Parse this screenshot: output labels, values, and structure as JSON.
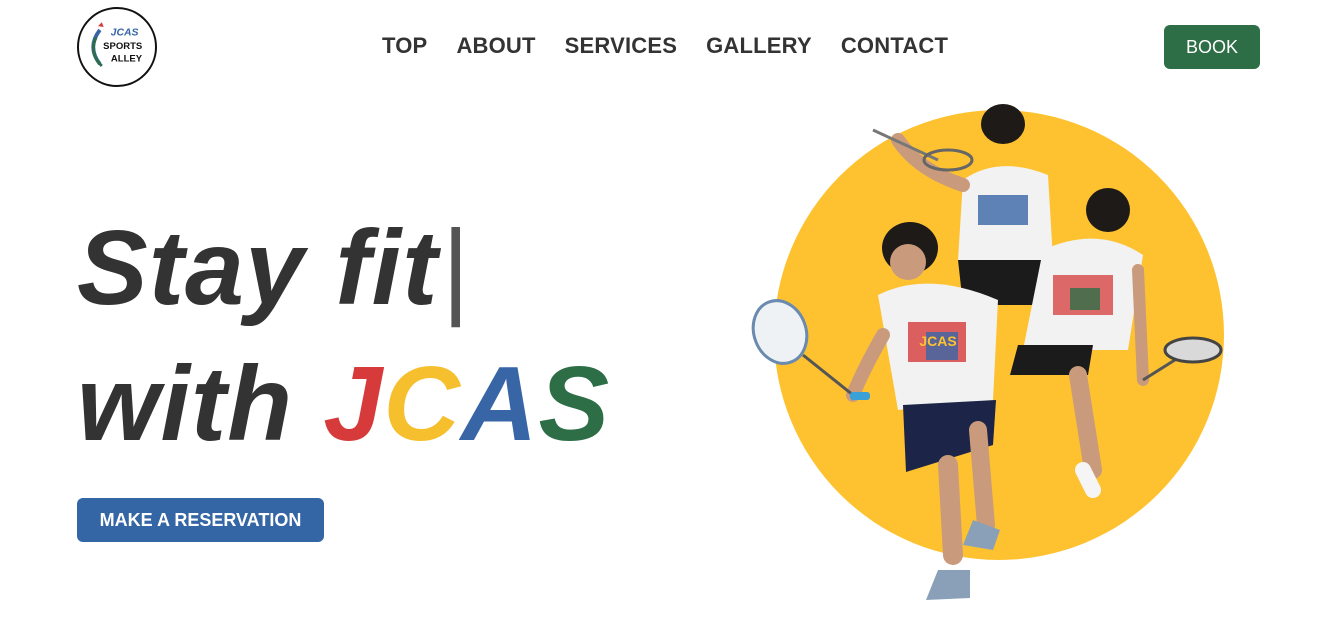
{
  "logo": {
    "line1": "JCAS",
    "line2": "SPORTS",
    "line3": "ALLEY"
  },
  "nav": {
    "items": [
      {
        "label": "TOP"
      },
      {
        "label": "ABOUT"
      },
      {
        "label": "SERVICES"
      },
      {
        "label": "GALLERY"
      },
      {
        "label": "CONTACT"
      }
    ]
  },
  "header": {
    "book_label": "BOOK"
  },
  "hero": {
    "line1": "Stay fit",
    "cursor": "|",
    "line2_prefix": "with",
    "brand_letters": [
      "J",
      "C",
      "A",
      "S"
    ],
    "cta_label": "MAKE A RESERVATION",
    "shirt_text": "JCAS"
  },
  "colors": {
    "text": "#333333",
    "red": "#d63a3a",
    "yellow": "#f6bf2e",
    "blue": "#3465a4",
    "green": "#2d6e47",
    "circle": "#fec230"
  }
}
